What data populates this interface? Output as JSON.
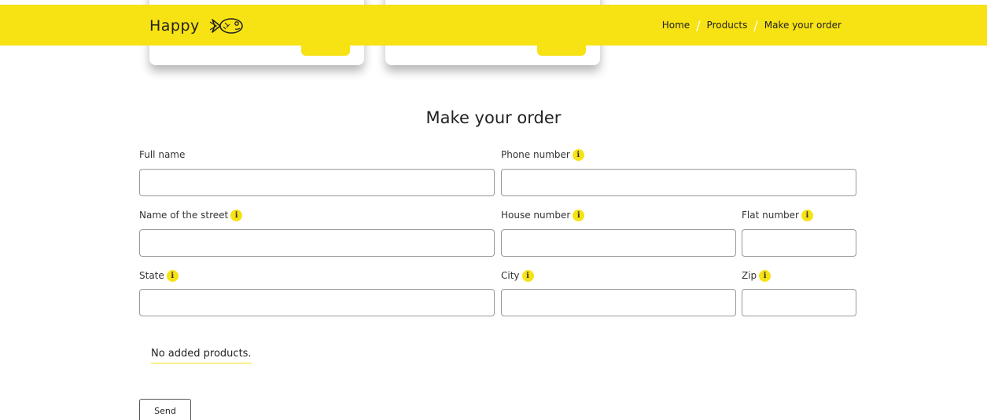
{
  "header": {
    "logo_text": "Happy",
    "logo_icon": "fish-icon",
    "accent_color": "#f7e214",
    "breadcrumb": {
      "home": "Home",
      "separator": "/",
      "products": "Products",
      "current": "Make your order"
    }
  },
  "page": {
    "title": "Make your order"
  },
  "form": {
    "full_name": {
      "label": "Full name",
      "value": ""
    },
    "phone_number": {
      "label": "Phone number",
      "value": ""
    },
    "street": {
      "label": "Name of the street",
      "value": ""
    },
    "house_number": {
      "label": "House number",
      "value": ""
    },
    "flat_number": {
      "label": "Flat number",
      "value": ""
    },
    "state": {
      "label": "State",
      "value": ""
    },
    "city": {
      "label": "City",
      "value": ""
    },
    "zip": {
      "label": "Zip",
      "value": ""
    },
    "info_icon": "info-icon",
    "info_glyph": "i"
  },
  "cart": {
    "empty_message": "No added products."
  },
  "actions": {
    "send_label": "Send"
  }
}
